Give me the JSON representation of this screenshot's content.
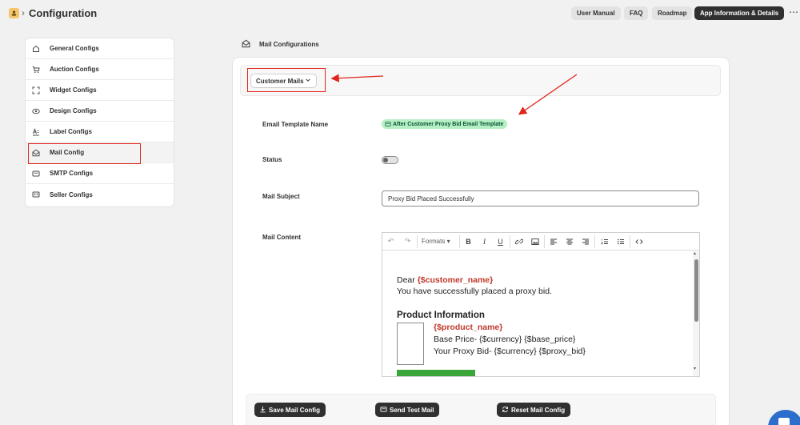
{
  "header": {
    "title": "Configuration",
    "buttons": {
      "user_manual": "User Manual",
      "faq": "FAQ",
      "roadmap": "Roadmap",
      "app_info": "App Information & Details"
    },
    "more": "⋯"
  },
  "sidebar": {
    "items": [
      {
        "label": "General Configs",
        "icon": "home-icon"
      },
      {
        "label": "Auction Configs",
        "icon": "cart-icon"
      },
      {
        "label": "Widget Configs",
        "icon": "frame-icon"
      },
      {
        "label": "Design Configs",
        "icon": "eye-icon"
      },
      {
        "label": "Label Configs",
        "icon": "label-icon"
      },
      {
        "label": "Mail Config",
        "icon": "mail-open-icon",
        "active": true
      },
      {
        "label": "SMTP Configs",
        "icon": "mail-icon"
      },
      {
        "label": "Seller Configs",
        "icon": "id-card-icon"
      }
    ]
  },
  "main": {
    "section_title": "Mail Configurations",
    "dropdown": {
      "selected": "Customer Mails"
    },
    "fields": {
      "template_name_label": "Email Template Name",
      "template_name_value": "After Customer Proxy Bid Email Template",
      "status_label": "Status",
      "status_on": false,
      "subject_label": "Mail Subject",
      "subject_value": "Proxy Bid Placed Successfully",
      "content_label": "Mail Content"
    },
    "editor": {
      "toolbar": {
        "formats": "Formats"
      },
      "greeting": "Dear ",
      "customer_var": "{$customer_name}",
      "line1": "You have successfully placed a proxy bid.",
      "heading": "Product Information",
      "product_var": "{$product_name}",
      "base_price": "Base Price- {$currency} {$base_price}",
      "proxy_bid": "Your Proxy Bid- {$currency} {$proxy_bid}"
    },
    "actions": {
      "save": "Save Mail Config",
      "test": "Send Test Mail",
      "reset": "Reset Mail Config"
    }
  },
  "colors": {
    "accent_dark": "#303030",
    "annotation_red": "#e1251b",
    "badge_green": "#b4f0c4",
    "variable_red": "#c0392b",
    "chat_blue": "#2c6ecb"
  }
}
